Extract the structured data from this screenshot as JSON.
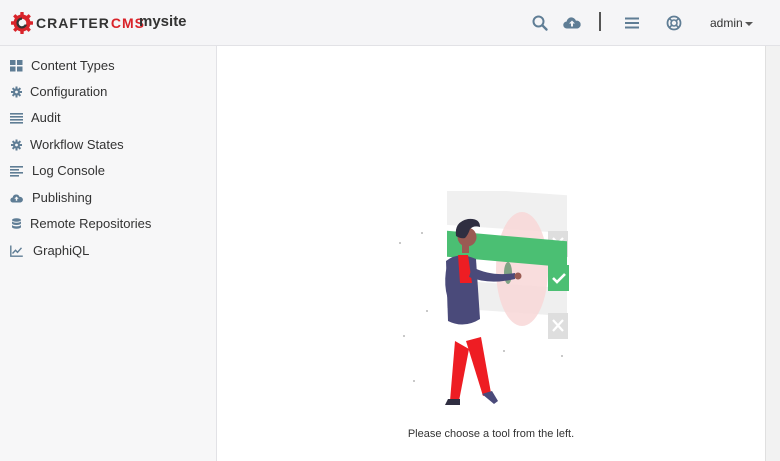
{
  "header": {
    "brand_prefix": "CRAFTER",
    "brand_suffix": "CMS",
    "site_name": "mysite",
    "user": "admin",
    "icons": [
      "search-icon",
      "publish-cloud-icon",
      "menu-icon",
      "help-lifebuoy-icon"
    ]
  },
  "sidebar": {
    "items": [
      {
        "label": "Content Types",
        "icon": "grid-icon"
      },
      {
        "label": "Configuration",
        "icon": "gear-icon"
      },
      {
        "label": "Audit",
        "icon": "list-icon"
      },
      {
        "label": "Workflow States",
        "icon": "gear-icon"
      },
      {
        "label": "Log Console",
        "icon": "align-left-icon"
      },
      {
        "label": "Publishing",
        "icon": "cloud-upload-icon"
      },
      {
        "label": "Remote Repositories",
        "icon": "database-icon"
      },
      {
        "label": "GraphiQL",
        "icon": "line-chart-icon"
      }
    ]
  },
  "main": {
    "empty_message": "Please choose a tool from the left."
  },
  "colors": {
    "brand_red": "#d9232a",
    "icon_blue": "#5f7d95",
    "check_green": "#4bbf73",
    "figure_red": "#ee1d23",
    "figure_purple": "#4a4a7a"
  }
}
